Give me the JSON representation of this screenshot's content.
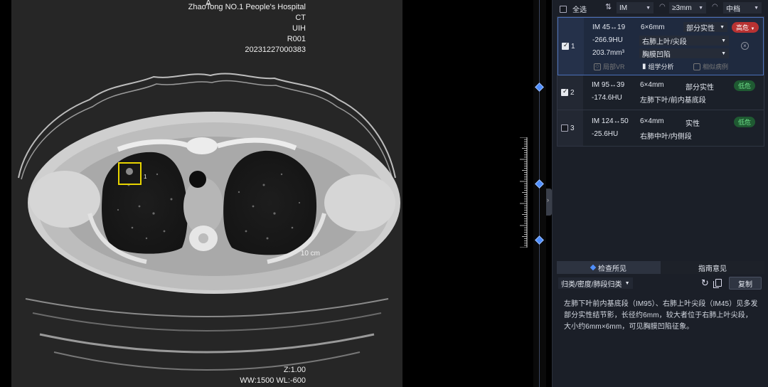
{
  "viewer": {
    "orientation_top": "A",
    "hospital": "ZhaoTong NO.1 People's Hospital",
    "modality": "CT",
    "manufacturer": "UIH",
    "series": "R001",
    "study_id": "20231227000383",
    "scale_label": "10 cm",
    "zoom": "Z:1.00",
    "window": "WW:1500 WL:-600",
    "roi_label": "1"
  },
  "filter_bar": {
    "select_all_label": "全选",
    "sort_select": "IM",
    "size_select": "≥3mm",
    "risk_select": "中档"
  },
  "findings": [
    {
      "index": "1",
      "checked": true,
      "im": "IM 45↔19",
      "size": "6×6mm",
      "density": "部分实性",
      "risk": "高危",
      "hu": "-266.9HU",
      "location": "右肺上叶/尖段",
      "volume": "203.7mm³",
      "sign": "胸膜凹陷",
      "tools": [
        "局部VR",
        "组学分析",
        "相似病例"
      ]
    },
    {
      "index": "2",
      "checked": true,
      "im": "IM 95↔39",
      "size": "6×4mm",
      "density": "部分实性",
      "risk": "低危",
      "hu": "-174.6HU",
      "location": "左肺下叶/前内基底段"
    },
    {
      "index": "3",
      "checked": false,
      "im": "IM 124↔50",
      "size": "6×4mm",
      "density": "实性",
      "risk": "低危",
      "hu": "-25.6HU",
      "location": "右肺中叶/内侧段"
    }
  ],
  "bottom": {
    "tab_findings": "检查所见",
    "tab_guide": "指南意见",
    "class_select": "归类/密度/肺段归类",
    "copy_label": "复制",
    "report_text": "左肺下叶前内基底段（IM95）、右肺上叶尖段（IM45）见多发部分实性结节影，长径约6mm，较大者位于右肺上叶尖段，大小约6mm×6mm，可见胸膜凹陷征象。"
  },
  "colors": {
    "accent": "#4f8fff",
    "high_risk": "#b83232",
    "low_risk": "#1f5a32",
    "roi": "#e8d400"
  }
}
